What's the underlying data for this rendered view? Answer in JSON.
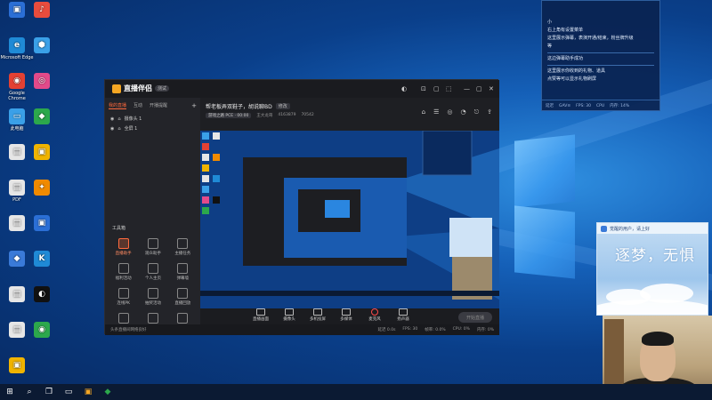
{
  "desktop_icons": [
    {
      "label": "",
      "glyph": "▣",
      "color": "#2b6fd6"
    },
    {
      "label": "Microsoft Edge",
      "glyph": "e",
      "color": "#1f8ad6"
    },
    {
      "label": "Google Chrome",
      "glyph": "◉",
      "color": "#e34133"
    },
    {
      "label": "此电脑",
      "glyph": "▭",
      "color": "#3aa0e8"
    },
    {
      "label": "",
      "glyph": "▤",
      "color": "#e6e6e6"
    },
    {
      "label": "PDF",
      "glyph": "▤",
      "color": "#e6e6e6"
    },
    {
      "label": "",
      "glyph": "▤",
      "color": "#e6e6e6"
    },
    {
      "label": "",
      "glyph": "◆",
      "color": "#3a7ad8"
    },
    {
      "label": "",
      "glyph": "▤",
      "color": "#e6e6e6"
    },
    {
      "label": "",
      "glyph": "▤",
      "color": "#e6e6e6"
    },
    {
      "label": "",
      "glyph": "▣",
      "color": "#f0b400"
    },
    {
      "label": "",
      "glyph": "♪",
      "color": "#e84c3d"
    },
    {
      "label": "",
      "glyph": "⬢",
      "color": "#3aa0e8"
    },
    {
      "label": "",
      "glyph": "◎",
      "color": "#e34a8a"
    },
    {
      "label": "",
      "glyph": "◆",
      "color": "#2ca84c"
    },
    {
      "label": "",
      "glyph": "▣",
      "color": "#f0b400"
    },
    {
      "label": "",
      "glyph": "✦",
      "color": "#f08a00"
    },
    {
      "label": "",
      "glyph": "▣",
      "color": "#2b6fd6"
    },
    {
      "label": "",
      "glyph": "K",
      "color": "#1f8ad6"
    },
    {
      "label": "",
      "glyph": "◐",
      "color": "#111111"
    },
    {
      "label": "",
      "glyph": "◉",
      "color": "#2ca84c"
    }
  ],
  "taskbar": {
    "start": "⊞",
    "search": "⌕",
    "task_view": "❐",
    "apps": [
      "▭",
      "▣",
      "◆"
    ]
  },
  "app": {
    "brand": "直播伴侣",
    "version": "测试",
    "window_controls": [
      "◐",
      "⊡",
      "▢",
      "⬚",
      "—",
      "▢",
      "✕"
    ],
    "sidebar": {
      "tabs": [
        "我的直播",
        "互动",
        "开播提醒"
      ],
      "add": "+",
      "sources": [
        "摄像头 1",
        "全屏 1"
      ],
      "tools_title": "工具箱",
      "tools": [
        {
          "label": "直播助手",
          "hot": true
        },
        {
          "label": "观众助手",
          "hot": false
        },
        {
          "label": "主播任务",
          "hot": false
        },
        {
          "label": "福利活动",
          "hot": false
        },
        {
          "label": "个人主页",
          "hot": false
        },
        {
          "label": "弹幕墙",
          "hot": false
        },
        {
          "label": "连线PK",
          "hot": false
        },
        {
          "label": "抽奖活动",
          "hot": false
        },
        {
          "label": "直播回放",
          "hot": false
        },
        {
          "label": "",
          "hot": false
        },
        {
          "label": "",
          "hot": false
        },
        {
          "label": "",
          "hot": false
        }
      ]
    },
    "room": {
      "title": "帮老板弄双鞋子，胡说聊BD",
      "tag": "修改",
      "category": "游戏之路 PCE · 00:00",
      "meta": [
        "王大龙哥",
        "4163879",
        "70542"
      ]
    },
    "top_icons": [
      "⌂",
      "☰",
      "◎",
      "◔",
      "⎋",
      "⇪"
    ],
    "bottom_bar": [
      {
        "label": "直播画面"
      },
      {
        "label": "摄像头"
      },
      {
        "label": "多机投屏"
      },
      {
        "label": "多媒体"
      },
      {
        "label": "麦克风",
        "rec": true
      },
      {
        "label": "扬声器"
      }
    ],
    "start_button": "开始直播",
    "status": {
      "left": "头条直播间网络良好",
      "right": [
        "延迟 0.0s",
        "FPS: 30",
        "帧率: 0.0%",
        "CPU: 0%",
        "内存: 0%"
      ]
    }
  },
  "chat": {
    "lines": [
      "小",
      "右上角有设置菜单",
      "这里展示弹幕，表演开通/结束，粉丝牌升级",
      "等",
      "这边弹幕助手成功",
      "这里展示你收到的礼物、道具",
      "点赞等可以显示礼物刷屏"
    ],
    "footer": [
      "延迟",
      "GAV≡",
      "FPS: 30",
      "CPU",
      "内存: 14%"
    ]
  },
  "banner": {
    "head": "觉醒的用户，请上好",
    "text": "逐梦，无惧"
  }
}
